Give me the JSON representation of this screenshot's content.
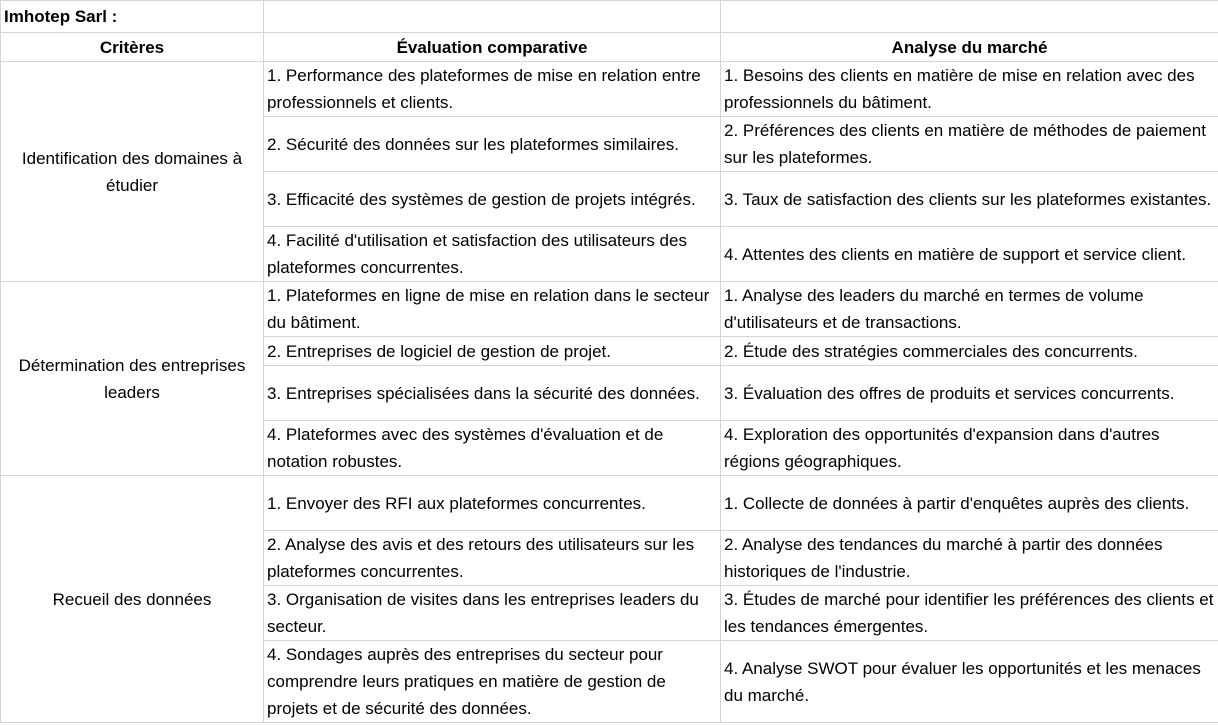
{
  "company": "Imhotep Sarl :",
  "headers": {
    "criteria": "Critères",
    "comparative": "Évaluation comparative",
    "market": "Analyse du marché"
  },
  "groups": [
    {
      "criterion": "Identification des domaines à étudier",
      "rows": [
        {
          "comparative": "1. Performance des plateformes de mise en relation entre professionnels et clients.",
          "market": "1. Besoins des clients en matière de mise en relation avec des professionnels du bâtiment."
        },
        {
          "comparative": "2. Sécurité des données sur les plateformes similaires.",
          "market": "2. Préférences des clients en matière de méthodes de paiement sur les plateformes."
        },
        {
          "comparative": "3. Efficacité des systèmes de gestion de projets intégrés.",
          "market": "3. Taux de satisfaction des clients sur les plateformes existantes."
        },
        {
          "comparative": "4. Facilité d'utilisation et satisfaction des utilisateurs des plateformes concurrentes.",
          "market": "4. Attentes des clients en matière de support et service client."
        }
      ]
    },
    {
      "criterion": "Détermination des entreprises leaders",
      "rows": [
        {
          "comparative": "1. Plateformes en ligne de mise en relation dans le secteur du bâtiment.",
          "market": "1. Analyse des leaders du marché en termes de volume d'utilisateurs et de transactions."
        },
        {
          "comparative": "2. Entreprises de logiciel de gestion de projet.",
          "market": "2. Étude des stratégies commerciales des concurrents."
        },
        {
          "comparative": "3. Entreprises spécialisées dans la sécurité des données.",
          "market": "3. Évaluation des offres de produits et services concurrents."
        },
        {
          "comparative": "4. Plateformes avec des systèmes d'évaluation et de notation robustes.",
          "market": "4. Exploration des opportunités d'expansion dans d'autres régions géographiques."
        }
      ]
    },
    {
      "criterion": "Recueil des données",
      "rows": [
        {
          "comparative": "1. Envoyer des RFI aux plateformes concurrentes.",
          "market": "1. Collecte de données à partir d'enquêtes auprès des clients."
        },
        {
          "comparative": "2. Analyse des avis et des retours des utilisateurs sur les plateformes concurrentes.",
          "market": "2. Analyse des tendances du marché à partir des données historiques de l'industrie."
        },
        {
          "comparative": "3. Organisation de visites dans les entreprises leaders du secteur.",
          "market": "3. Études de marché pour identifier les préférences des clients et les tendances émergentes."
        },
        {
          "comparative": "4. Sondages auprès des entreprises du secteur pour comprendre leurs pratiques en matière de gestion de projets et de sécurité des données.",
          "market": "4. Analyse SWOT pour évaluer les opportunités et les menaces du marché."
        }
      ]
    }
  ]
}
